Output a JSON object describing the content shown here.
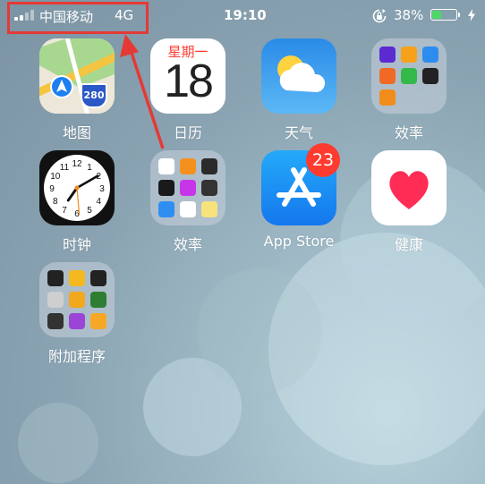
{
  "status_bar": {
    "carrier": "中国移动",
    "network": "4G",
    "time": "19:10",
    "battery_percent": "38%",
    "battery_level": 0.38,
    "icons": [
      "signal-icon",
      "rotation-lock-icon",
      "battery-icon",
      "charging-icon"
    ]
  },
  "annotation": {
    "highlight_color": "#e53935"
  },
  "calendar": {
    "weekday": "星期一",
    "date": "18"
  },
  "maps": {
    "highway_number": "280"
  },
  "badge": {
    "app_store_count": "23"
  },
  "apps": {
    "maps": "地图",
    "calendar": "日历",
    "weather": "天气",
    "efficiency_1": "效率",
    "clock": "时钟",
    "efficiency_2": "效率",
    "app_store": "App Store",
    "health": "健康",
    "extras": "附加程序"
  },
  "colors": {
    "accent_red": "#ff3b30",
    "app_store_blue": "#1e8cf5",
    "weather_blue": "#2f9df0"
  }
}
